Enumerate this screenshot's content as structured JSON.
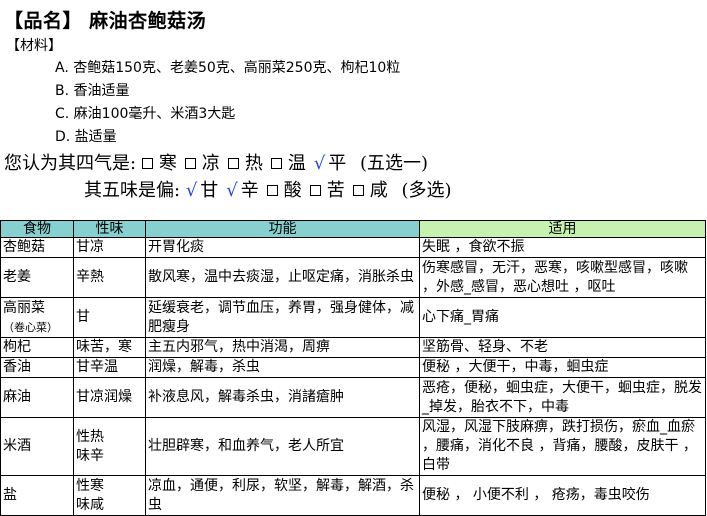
{
  "recipe": {
    "title": "【品名】 麻油杏鲍菇汤",
    "materials_heading": "【材料】",
    "materials": [
      "A. 杏鲍菇150克、老姜50克、高丽菜250克、枸杞10粒",
      "B. 香油适量",
      "C. 麻油100毫升、米酒3大匙",
      "D. 盐适量"
    ]
  },
  "question1": {
    "prompt": "您认为其四气是:",
    "options": [
      {
        "label": "寒",
        "checked": false
      },
      {
        "label": "凉",
        "checked": false
      },
      {
        "label": "热",
        "checked": false
      },
      {
        "label": "温",
        "checked": false
      },
      {
        "label": "平",
        "checked": true
      }
    ],
    "note": "(五选一)"
  },
  "question2": {
    "prompt": "其五味是偏:",
    "options": [
      {
        "label": "甘",
        "checked": true
      },
      {
        "label": "辛",
        "checked": true
      },
      {
        "label": "酸",
        "checked": false
      },
      {
        "label": "苦",
        "checked": false
      },
      {
        "label": "咸",
        "checked": false
      }
    ],
    "note": "(多选)"
  },
  "check_symbol": "√",
  "colors": {
    "check": "#1e49d6",
    "header_teal": "#86d0d0",
    "header_green": "#c6f1ae"
  },
  "table": {
    "headers": [
      "食物",
      "性味",
      "功能",
      "适用"
    ],
    "rows": [
      {
        "food": "杏鲍菇",
        "nature": "甘凉",
        "function": "开胃化痰",
        "usage": "失眠 ，食欲不振"
      },
      {
        "food": "老姜",
        "nature": "辛熱",
        "function": "散风寒，温中去痰湿，止呕定痛，消胀杀虫",
        "usage": "伤寒感冒，无汗，恶寒，咳嗽型感冒，咳嗽 ，外感_感冒，恶心想吐 ，呕吐"
      },
      {
        "food": "高丽菜",
        "food_note": "（卷心菜）",
        "nature": "甘",
        "function": "延缓衰老，调节血压，养胃，强身健体，减肥瘦身",
        "usage": "心下痛_胃痛"
      },
      {
        "food": "枸杞",
        "nature": "味苦，寒",
        "function": "主五内邪气，热中消渴，周痹",
        "usage": "坚筋骨、轻身、不老"
      },
      {
        "food": "香油",
        "nature": "甘辛温",
        "function": "润燥，解毒，杀虫",
        "usage": "便秘 ，大便干，中毒，蛔虫症"
      },
      {
        "food": "麻油",
        "nature": "甘凉润燥",
        "function": "补液息风，解毒杀虫，消諸瘡肿",
        "usage": "恶疮，便秘，蛔虫症，大便干，蛔虫症，脱发_掉发，胎衣不下，中毒"
      },
      {
        "food": "米酒",
        "nature": "性热\n味辛",
        "function": "壮胆辟寒，和血养气，老人所宜",
        "usage": "风湿，风湿下肢麻痹，跌打损伤，瘀血_血瘀 ，腰痛，消化不良 ，背痛，腰酸，皮肤干 ，白带"
      },
      {
        "food": "盐",
        "nature": "性寒\n味咸",
        "function": "凉血，通便，利尿，软坚，解毒，解酒，杀虫",
        "usage": " 便秘 ， 小便不利 ， 疮疡，毒虫咬伤"
      }
    ]
  }
}
